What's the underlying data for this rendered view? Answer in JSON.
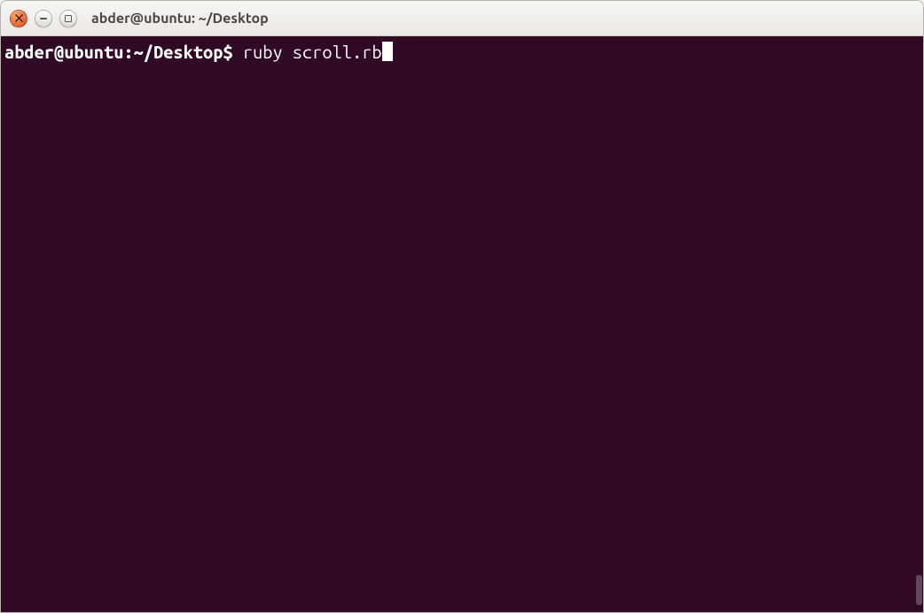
{
  "window": {
    "title": "abder@ubuntu: ~/Desktop"
  },
  "terminal": {
    "prompt": "abder@ubuntu:~/Desktop$ ",
    "command": "ruby scroll.rb"
  }
}
